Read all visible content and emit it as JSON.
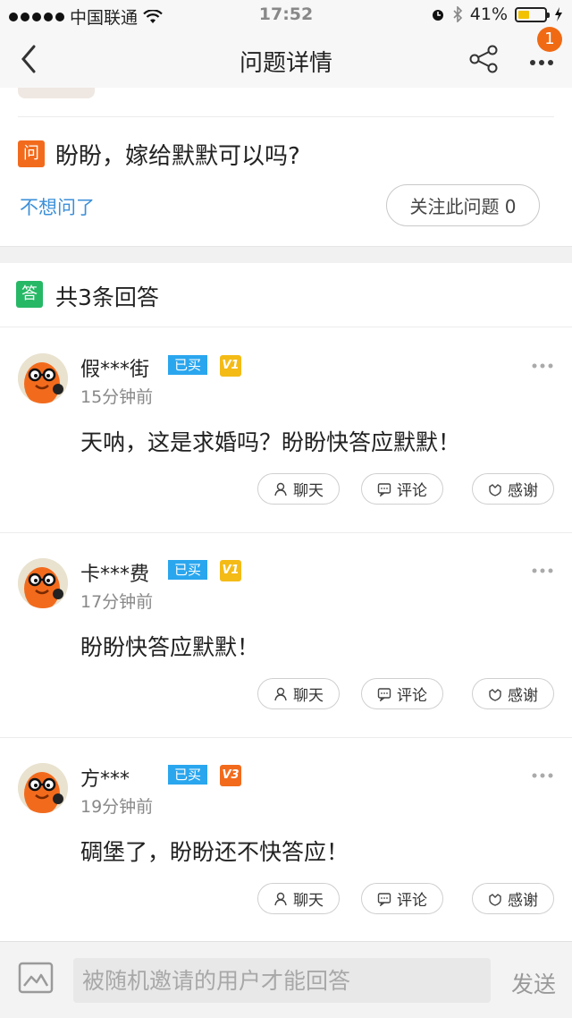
{
  "status_bar": {
    "carrier": "中国联通",
    "time": "17:52",
    "battery": "41%"
  },
  "nav": {
    "title": "问题详情",
    "badge": "1"
  },
  "question": {
    "icon_label": "问",
    "text": "盼盼，嫁给默默可以吗?",
    "no_ask": "不想问了",
    "follow": "关注此问题 0"
  },
  "answers_header": {
    "icon_label": "答",
    "count_text": "共3条回答"
  },
  "answers": [
    {
      "name": "假***街",
      "bought": "已买",
      "level": "V1",
      "time": "15分钟前",
      "text": "天呐，这是求婚吗？盼盼快答应默默！"
    },
    {
      "name": "卡***费",
      "bought": "已买",
      "level": "V1",
      "time": "17分钟前",
      "text": "盼盼快答应默默！"
    },
    {
      "name": "方***",
      "bought": "已买",
      "level": "V3",
      "time": "19分钟前",
      "text": "碉堡了，盼盼还不快答应！"
    }
  ],
  "actions": {
    "chat": "聊天",
    "comment": "评论",
    "thanks": "感谢"
  },
  "bottom": {
    "placeholder": "被随机邀请的用户才能回答",
    "send": "发送"
  },
  "colors": {
    "accent_orange": "#f26b1d",
    "answer_green": "#27b866",
    "link_blue": "#3b8fd8",
    "bought_blue": "#2aa6ee",
    "level_yellow": "#f4bb17"
  }
}
